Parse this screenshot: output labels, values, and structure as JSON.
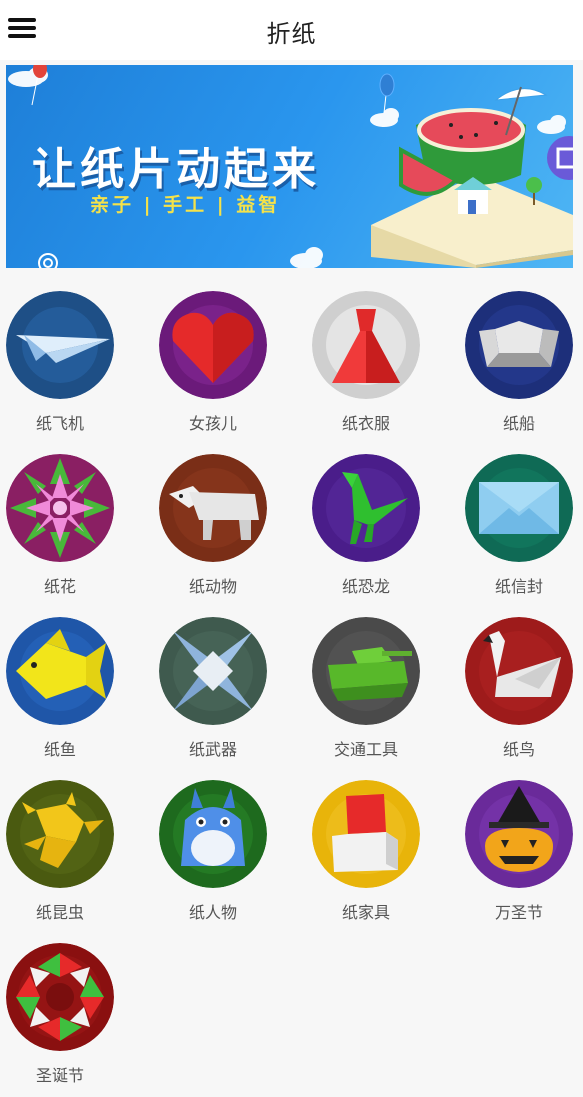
{
  "header": {
    "title": "折纸",
    "menu_icon": "hamburger-menu-icon"
  },
  "banner": {
    "headline": "让纸片动起来",
    "subline": "亲子 | 手工 | 益智"
  },
  "categories": [
    {
      "label": "纸飞机",
      "icon": "paper-airplane-icon",
      "bg": "#1e4f86"
    },
    {
      "label": "女孩儿",
      "icon": "heart-icon",
      "bg": "#6b1a7a"
    },
    {
      "label": "纸衣服",
      "icon": "dress-icon",
      "bg": "#cfcfcf"
    },
    {
      "label": "纸船",
      "icon": "paper-boat-icon",
      "bg": "#1d2f7a"
    },
    {
      "label": "纸花",
      "icon": "flower-icon",
      "bg": "#8a1f63"
    },
    {
      "label": "纸动物",
      "icon": "polar-bear-icon",
      "bg": "#7a2e17"
    },
    {
      "label": "纸恐龙",
      "icon": "dinosaur-icon",
      "bg": "#4a1d8a"
    },
    {
      "label": "纸信封",
      "icon": "envelope-icon",
      "bg": "#0f6a55"
    },
    {
      "label": "纸鱼",
      "icon": "fish-icon",
      "bg": "#1f56a8"
    },
    {
      "label": "纸武器",
      "icon": "shuriken-icon",
      "bg": "#3f5a4e"
    },
    {
      "label": "交通工具",
      "icon": "tank-icon",
      "bg": "#4a4a4a"
    },
    {
      "label": "纸鸟",
      "icon": "swan-icon",
      "bg": "#9e1b1b"
    },
    {
      "label": "纸昆虫",
      "icon": "insect-icon",
      "bg": "#4a5a10"
    },
    {
      "label": "纸人物",
      "icon": "totoro-icon",
      "bg": "#1e6a1e"
    },
    {
      "label": "纸家具",
      "icon": "chair-icon",
      "bg": "#e8b40a"
    },
    {
      "label": "万圣节",
      "icon": "pumpkin-witch-hat-icon",
      "bg": "#6a2a9a"
    },
    {
      "label": "圣诞节",
      "icon": "wreath-icon",
      "bg": "#8a1010"
    }
  ]
}
